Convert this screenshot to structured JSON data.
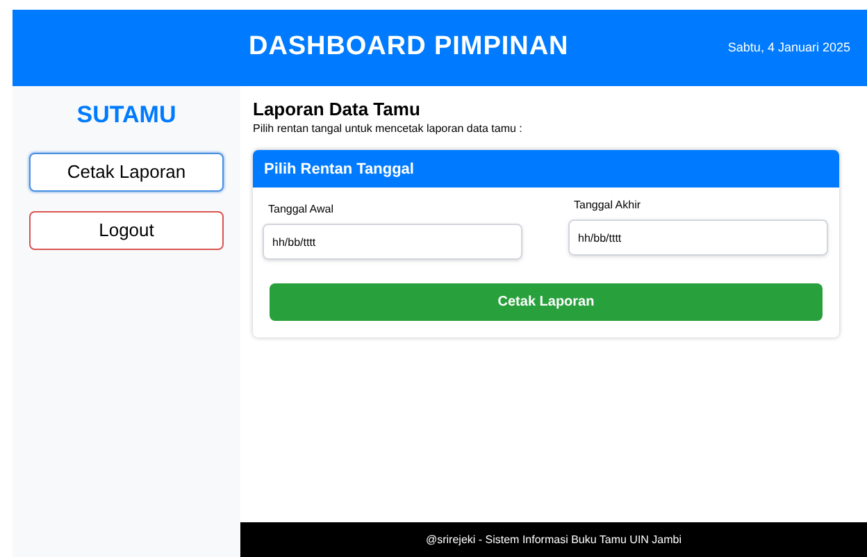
{
  "header": {
    "title": "DASHBOARD PIMPINAN",
    "date": "Sabtu, 4 Januari 2025"
  },
  "sidebar": {
    "brand": "SUTAMU",
    "buttons": [
      {
        "label": "Cetak Laporan",
        "kind": "primary"
      },
      {
        "label": "Logout",
        "kind": "danger"
      }
    ]
  },
  "page": {
    "title": "Laporan Data Tamu",
    "subtitle": "Pilih rentan tangal untuk mencetak laporan data tamu :"
  },
  "card": {
    "header": "Pilih Rentan Tanggal",
    "fields": [
      {
        "label": "Tanggal Awal",
        "placeholder": "hh/bb/tttt"
      },
      {
        "label": "Tanggal Akhir",
        "placeholder": "hh/bb/tttt"
      }
    ],
    "submit": "Cetak Laporan"
  },
  "footer": "@srirejeki - Sistem Informasi Buku Tamu UIN Jambi"
}
